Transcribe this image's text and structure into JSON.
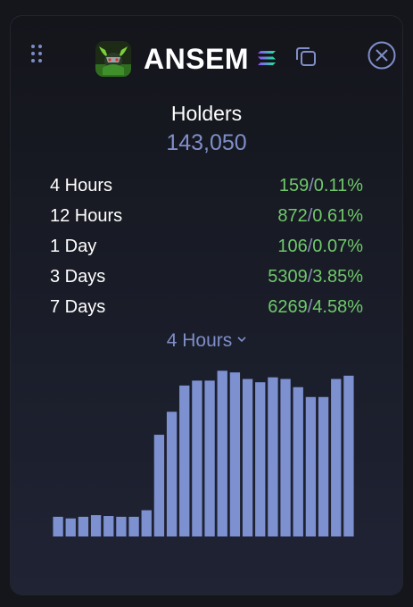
{
  "header": {
    "token_name": "ANSEM"
  },
  "holders": {
    "label": "Holders",
    "count": "143,050"
  },
  "stats": [
    {
      "label": "4 Hours",
      "count": "159",
      "percent": "0.11%"
    },
    {
      "label": "12 Hours",
      "count": "872",
      "percent": "0.61%"
    },
    {
      "label": "1 Day",
      "count": "106",
      "percent": "0.07%"
    },
    {
      "label": "3 Days",
      "count": "5309",
      "percent": "3.85%"
    },
    {
      "label": "7 Days",
      "count": "6269",
      "percent": "4.58%"
    }
  ],
  "period_select": {
    "selected": "4 Hours"
  },
  "colors": {
    "accent": "#7f8ec8",
    "positive": "#6fc96b",
    "bar": "#7d90d0",
    "background": "#15161b"
  },
  "icons": [
    "drag-handle-icon",
    "token-logo",
    "solana-icon",
    "copy-icon",
    "close-icon",
    "chevron-down-icon"
  ],
  "chart_data": {
    "type": "bar",
    "values": [
      12,
      11,
      12,
      13,
      12.5,
      12,
      12,
      16,
      62,
      76,
      92,
      95,
      95,
      101,
      100,
      96,
      94,
      97,
      96,
      91,
      85,
      85,
      96,
      98
    ],
    "ylim": [
      0,
      105
    ]
  }
}
